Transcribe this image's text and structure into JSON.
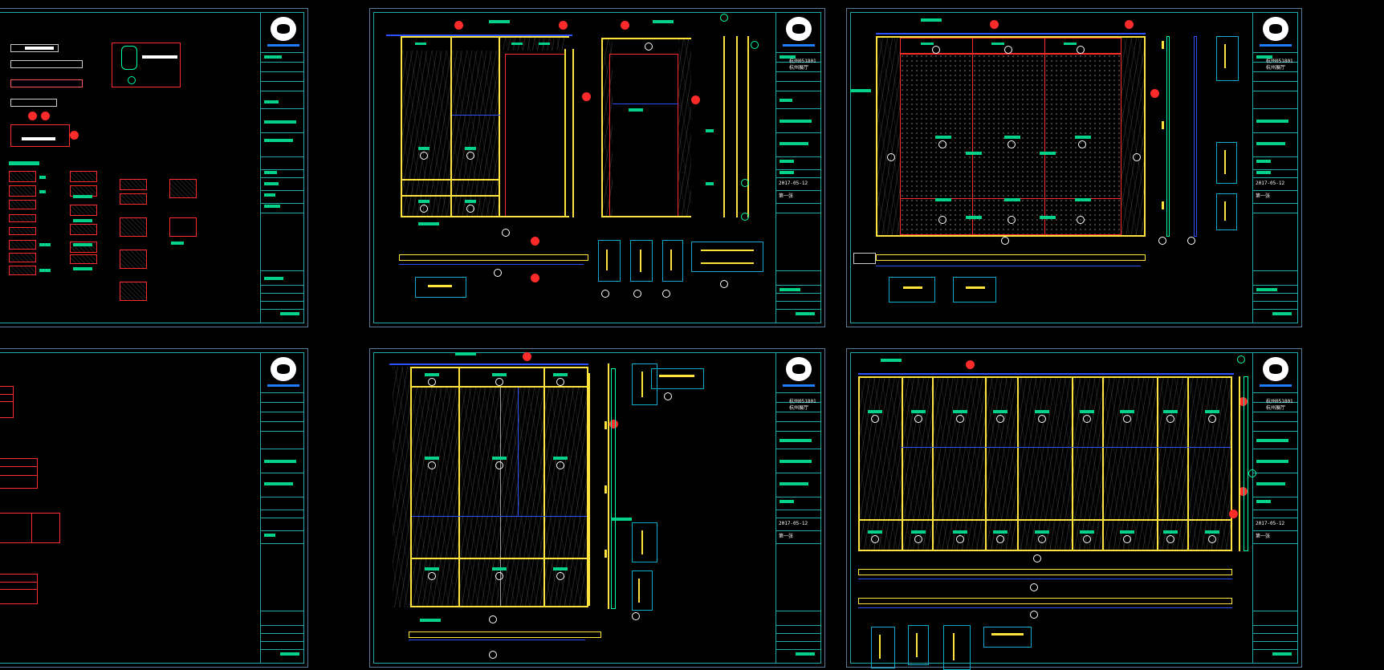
{
  "workspace": {
    "background": "#000000"
  },
  "colors": {
    "frame": "#5a7a9a",
    "yellow": "#ffe23a",
    "green_label": "#00d28a",
    "red": "#ff2a2a",
    "cyan": "#11aacc",
    "blue": "#2a50ff"
  },
  "sheets": [
    {
      "name": "legend-sheet",
      "date": "",
      "page": ""
    },
    {
      "name": "elevation-sheet-a",
      "project_code": "杭州051801",
      "client": "杭州展厅",
      "date": "2017-05-12",
      "page": "第一张"
    },
    {
      "name": "elevation-sheet-b",
      "project_code": "杭州051801",
      "client": "杭州展厅",
      "date": "2017-05-12",
      "page": "第一张"
    },
    {
      "name": "table-sheet",
      "date": "",
      "page": ""
    },
    {
      "name": "elevation-sheet-c",
      "project_code": "杭州051801",
      "client": "杭州展厅",
      "date": "2017-05-12",
      "page": "第一张"
    },
    {
      "name": "elevation-sheet-d",
      "project_code": "杭州051801",
      "client": "杭州展厅",
      "date": "2017-05-12",
      "page": "第一张"
    }
  ]
}
